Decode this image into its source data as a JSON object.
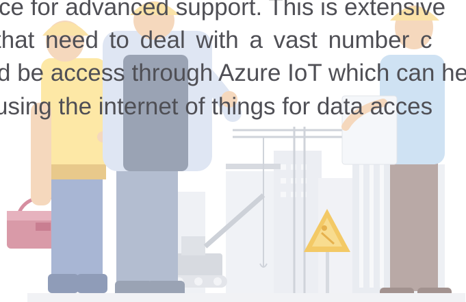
{
  "paragraph": {
    "lines": [
      "ce for advanced support. This is extensive",
      " that need to deal with a vast number c",
      "d be access through Azure IoT which can he",
      " using the internet of things for data acces"
    ]
  },
  "colors": {
    "text": "#4f4f55",
    "skin": "#f5d8bd",
    "helmet": "#fbe3a8",
    "shirt_left": "#fde8a6",
    "shirt_mid": "#dfe6f3",
    "shirt_right": "#cfe2f3",
    "vest": "#9aa3b4",
    "pants_blue": "#a8b6d4",
    "pants_brown": "#b9a9a6",
    "toolbox": "#d99aa8",
    "crane": "#c9ccd2",
    "buildings": "#eef0f4",
    "warning_sign": "#f3c966"
  }
}
